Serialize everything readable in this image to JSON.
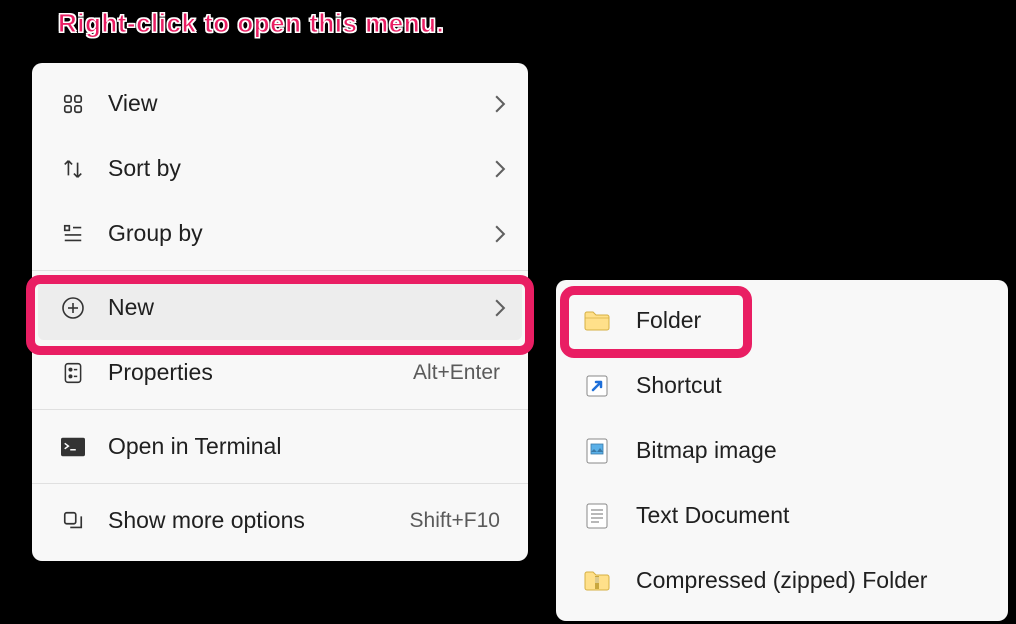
{
  "annotation": "Right-click to open this menu.",
  "menu": {
    "view": {
      "label": "View"
    },
    "sortby": {
      "label": "Sort by"
    },
    "groupby": {
      "label": "Group by"
    },
    "new": {
      "label": "New"
    },
    "properties": {
      "label": "Properties",
      "shortcut": "Alt+Enter"
    },
    "terminal": {
      "label": "Open in Terminal"
    },
    "more": {
      "label": "Show more options",
      "shortcut": "Shift+F10"
    }
  },
  "submenu": {
    "folder": {
      "label": "Folder"
    },
    "shortcut": {
      "label": "Shortcut"
    },
    "bitmap": {
      "label": "Bitmap image"
    },
    "text": {
      "label": "Text Document"
    },
    "zip": {
      "label": "Compressed (zipped) Folder"
    }
  }
}
